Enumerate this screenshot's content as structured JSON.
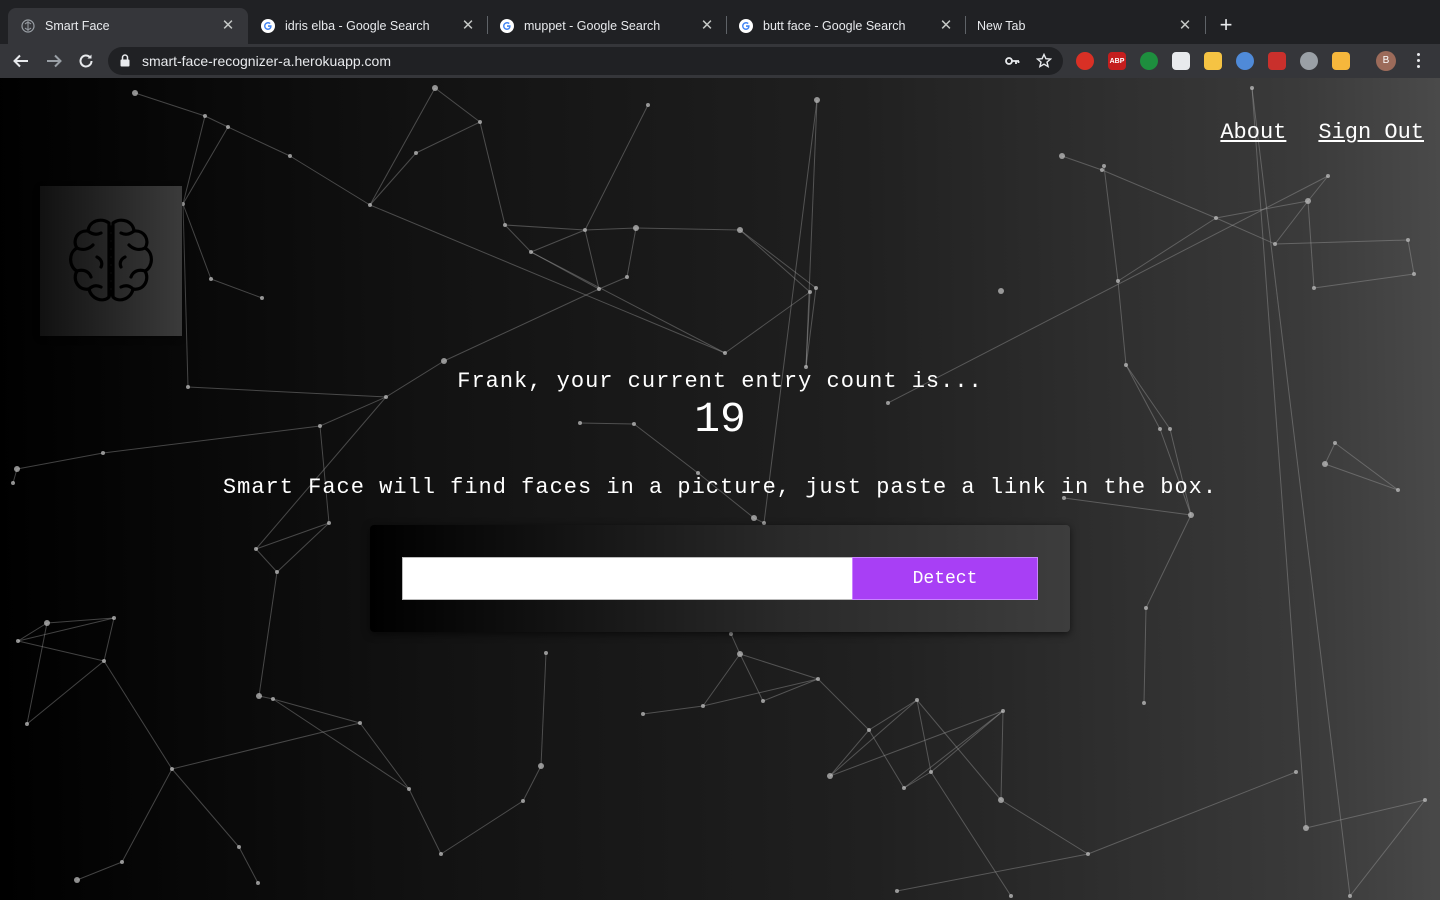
{
  "browser": {
    "tabs": [
      {
        "title": "Smart Face",
        "icon": "smart-face-favicon",
        "active": true
      },
      {
        "title": "idris elba - Google Search",
        "icon": "google-icon",
        "active": false
      },
      {
        "title": "muppet - Google Search",
        "icon": "google-icon",
        "active": false
      },
      {
        "title": "butt face - Google Search",
        "icon": "google-icon",
        "active": false
      },
      {
        "title": "New Tab",
        "icon": "",
        "active": false
      }
    ],
    "url": "smart-face-recognizer-a.herokuapp.com",
    "extensions": [
      {
        "name": "red-shield-extension-icon",
        "label": "",
        "color": "#d93025"
      },
      {
        "name": "adblock-plus-icon",
        "label": "ABP",
        "color": "#c41e1e"
      },
      {
        "name": "green-leaf-extension-icon",
        "label": "",
        "color": "#1e8e3e"
      },
      {
        "name": "red-box-extension-icon",
        "label": "",
        "color": "#e8eaed"
      },
      {
        "name": "stack-extension-icon",
        "label": "",
        "color": "#f5c343"
      },
      {
        "name": "blue-circle-extension-icon",
        "label": "",
        "color": "#4f8ad8"
      },
      {
        "name": "red-gear-extension-icon",
        "label": "",
        "color": "#c9302c"
      },
      {
        "name": "target-extension-icon",
        "label": "",
        "color": "#9aa0a6"
      },
      {
        "name": "yellow-square-extension-icon",
        "label": "",
        "color": "#f6b73c"
      }
    ],
    "profile_initial": "B"
  },
  "nav": {
    "about": "About",
    "sign_out": "Sign Out"
  },
  "greeting": "Frank, your current entry count is...",
  "entry_count": "19",
  "tagline": "Smart Face will find faces in a picture, just paste a link in the box.",
  "form": {
    "input_value": "",
    "placeholder": "",
    "button_label": "Detect"
  },
  "colors": {
    "accent": "#a83ff5",
    "tab_bar": "#202124",
    "toolbar": "#35363a"
  }
}
